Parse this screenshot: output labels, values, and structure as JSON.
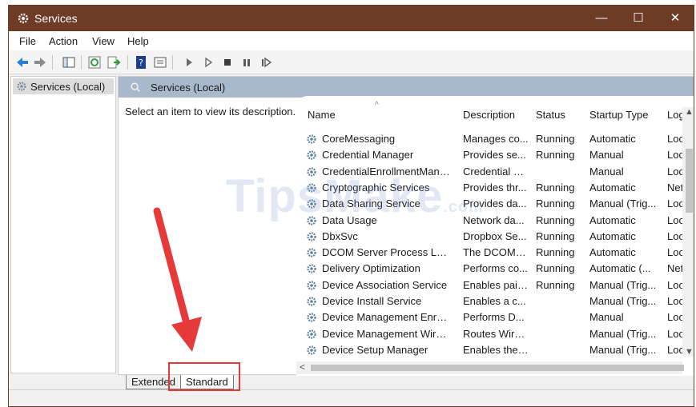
{
  "window": {
    "title": "Services",
    "app_icon": "gear-icon"
  },
  "titlebar_controls": {
    "minimize": "—",
    "maximize": "☐",
    "close": "✕"
  },
  "menu": [
    "File",
    "Action",
    "View",
    "Help"
  ],
  "toolbar": [
    "back-icon",
    "forward-icon",
    "show-tree-icon",
    "refresh-icon",
    "export-icon",
    "help-icon",
    "properties-icon",
    "start-icon",
    "start-alt-icon",
    "stop-icon",
    "pause-icon",
    "restart-icon"
  ],
  "tree": {
    "item_label": "Services (Local)"
  },
  "panel": {
    "header": "Services (Local)",
    "description_prompt": "Select an item to view its description."
  },
  "list": {
    "columns": [
      "Name",
      "Description",
      "Status",
      "Startup Type",
      "Log"
    ],
    "rows": [
      {
        "name": "CoreMessaging",
        "description": "Manages co...",
        "status": "Running",
        "startup": "Automatic",
        "log": "Loca"
      },
      {
        "name": "Credential Manager",
        "description": "Provides se...",
        "status": "Running",
        "startup": "Manual",
        "log": "Loca"
      },
      {
        "name": "CredentialEnrollmentMana...",
        "description": "Credential E...",
        "status": "",
        "startup": "Manual",
        "log": "Loca"
      },
      {
        "name": "Cryptographic Services",
        "description": "Provides thr...",
        "status": "Running",
        "startup": "Automatic",
        "log": "Netw"
      },
      {
        "name": "Data Sharing Service",
        "description": "Provides da...",
        "status": "Running",
        "startup": "Manual (Trig...",
        "log": "Loca"
      },
      {
        "name": "Data Usage",
        "description": "Network da...",
        "status": "Running",
        "startup": "Automatic",
        "log": "Loca"
      },
      {
        "name": "DbxSvc",
        "description": "Dropbox Se...",
        "status": "Running",
        "startup": "Automatic",
        "log": "Loca"
      },
      {
        "name": "DCOM Server Process Laun...",
        "description": "The DCOML...",
        "status": "Running",
        "startup": "Automatic",
        "log": "Loca"
      },
      {
        "name": "Delivery Optimization",
        "description": "Performs co...",
        "status": "Running",
        "startup": "Automatic (...",
        "log": "Netw"
      },
      {
        "name": "Device Association Service",
        "description": "Enables pair...",
        "status": "Running",
        "startup": "Manual (Trig...",
        "log": "Loca"
      },
      {
        "name": "Device Install Service",
        "description": "Enables a c...",
        "status": "",
        "startup": "Manual (Trig...",
        "log": "Loca"
      },
      {
        "name": "Device Management Enroll...",
        "description": "Performs D...",
        "status": "",
        "startup": "Manual",
        "log": "Loca"
      },
      {
        "name": "Device Management Wirele...",
        "description": "Routes Wire...",
        "status": "",
        "startup": "Manual (Trig...",
        "log": "Loca"
      },
      {
        "name": "Device Setup Manager",
        "description": "Enables the ...",
        "status": "",
        "startup": "Manual (Trig...",
        "log": "Loca"
      }
    ]
  },
  "tabs": {
    "extended": "Extended",
    "standard": "Standard"
  },
  "watermark": {
    "main": "TipsMake",
    "suffix": ".com"
  },
  "colors": {
    "titlebar": "#6e3b24",
    "panel_header": "#a9b9cc",
    "highlight": "#e5393a"
  }
}
